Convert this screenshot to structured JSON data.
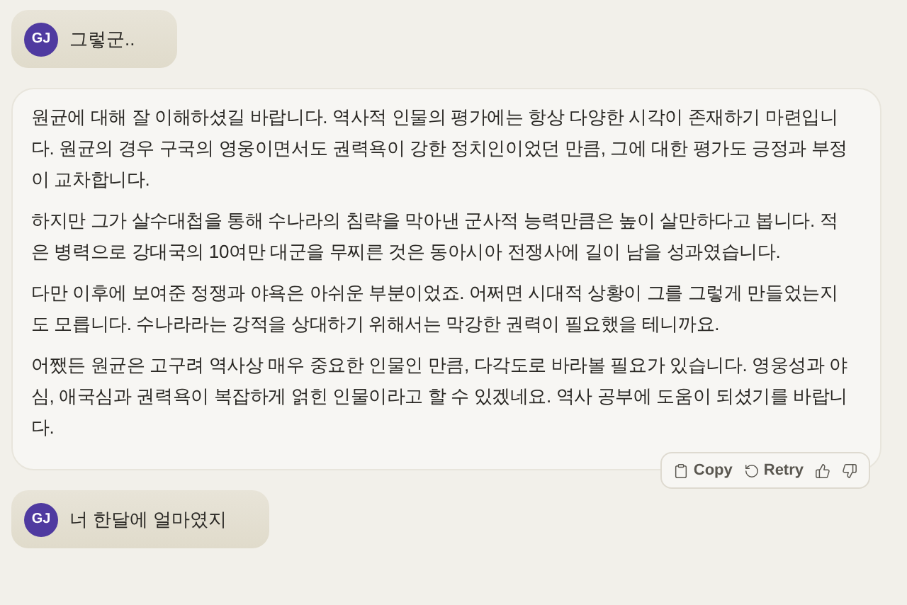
{
  "messages": [
    {
      "kind": "user",
      "avatar": "GJ",
      "text": "그렇군.."
    },
    {
      "kind": "assistant",
      "paragraphs": [
        "원균에 대해 잘 이해하셨길 바랍니다. 역사적 인물의 평가에는 항상 다양한 시각이 존재하기 마련입니다. 원균의 경우 구국의 영웅이면서도 권력욕이 강한 정치인이었던 만큼, 그에 대한 평가도 긍정과 부정이 교차합니다.",
        "하지만 그가 살수대첩을 통해 수나라의 침략을 막아낸 군사적 능력만큼은 높이 살만하다고 봅니다. 적은 병력으로 강대국의 10여만 대군을 무찌른 것은 동아시아 전쟁사에 길이 남을 성과였습니다.",
        "다만 이후에 보여준 정쟁과 야욕은 아쉬운 부분이었죠. 어쩌면 시대적 상황이 그를 그렇게 만들었는지도 모릅니다. 수나라라는 강적을 상대하기 위해서는 막강한 권력이 필요했을 테니까요.",
        "어쨌든 원균은 고구려 역사상 매우 중요한 인물인 만큼, 다각도로 바라볼 필요가 있습니다. 영웅성과 야심, 애국심과 권력욕이 복잡하게 얽힌 인물이라고 할 수 있겠네요. 역사 공부에 도움이 되셨기를 바랍니다."
      ],
      "actions": [
        {
          "kind": "copy",
          "label": "Copy"
        },
        {
          "kind": "retry",
          "label": "Retry"
        },
        {
          "kind": "like"
        },
        {
          "kind": "dislike"
        }
      ]
    },
    {
      "kind": "user",
      "avatar": "GJ",
      "text": "너 한달에 얼마였지"
    }
  ]
}
